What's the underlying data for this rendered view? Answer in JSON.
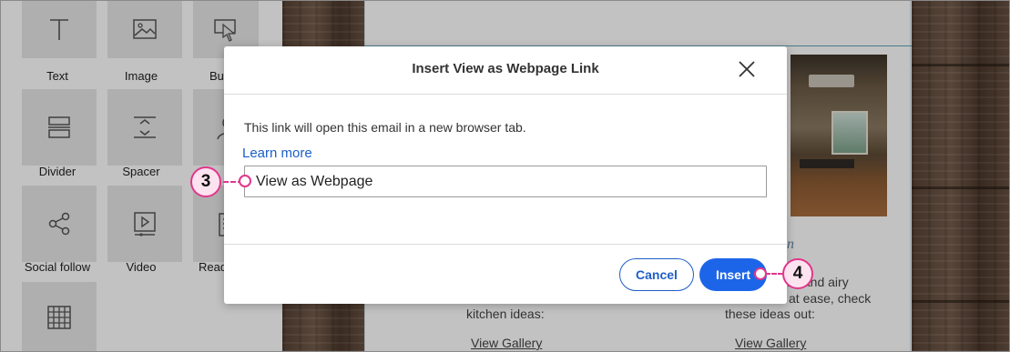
{
  "blocks": {
    "text": "Text",
    "image": "Image",
    "button": "But",
    "divider": "Divider",
    "spacer": "Spacer",
    "social_follow": "Social follow",
    "video": "Video",
    "read_more": "Read"
  },
  "canvas": {
    "heading_partial": "n",
    "col1_line1": "kitchen ideas:",
    "col2_line1": "ls, and airy",
    "col2_line2": "at ease, check",
    "col2_line3": "these ideas out:",
    "gallery_link_1": "View Gallery",
    "gallery_link_2": "View Gallery"
  },
  "modal": {
    "title": "Insert View as Webpage Link",
    "description": "This link will open this email in a new browser tab.",
    "learn_more": "Learn more",
    "input_value": "View as Webpage",
    "cancel_label": "Cancel",
    "insert_label": "Insert"
  },
  "callouts": {
    "step3": "3",
    "step4": "4"
  },
  "colors": {
    "accent_blue": "#1d65e8",
    "callout_pink": "#e0378c"
  }
}
